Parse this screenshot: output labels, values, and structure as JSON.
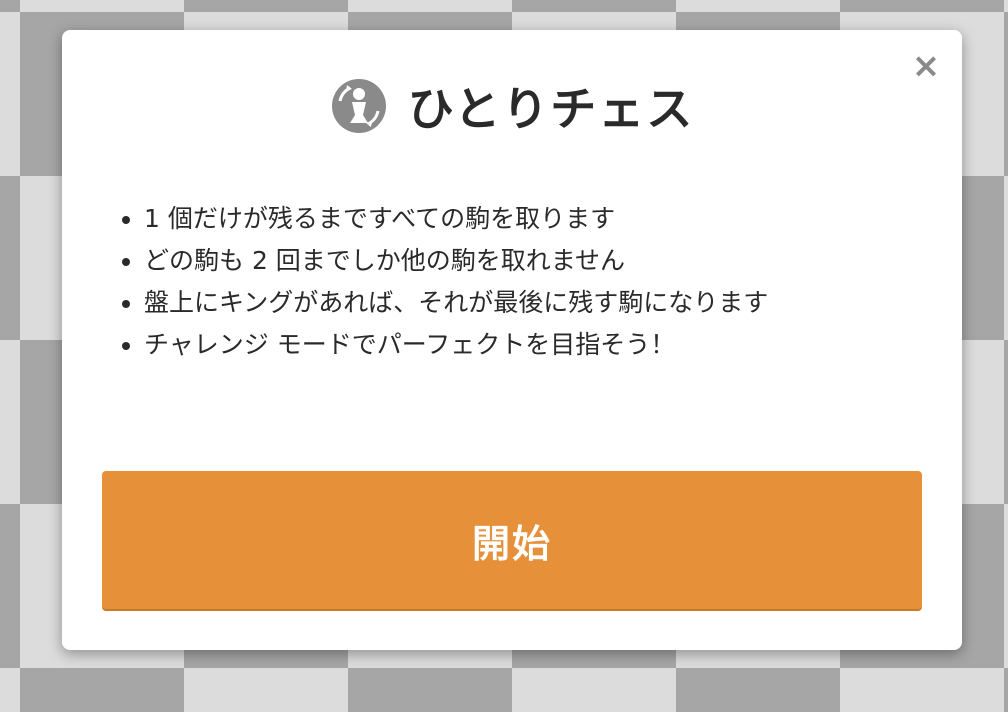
{
  "dialog": {
    "close_label": "×",
    "logo_icon": "solo-chess-piece-icon",
    "title": "ひとりチェス",
    "rules": [
      "1 個だけが残るまですべての駒を取ります",
      "どの駒も 2 回までしか他の駒を取れません",
      "盤上にキングがあれば、それが最後に残す駒になります",
      "チャレンジ モードでパーフェクトを目指そう！"
    ],
    "start_label": "開始"
  },
  "colors": {
    "accent": "#e6913a",
    "board_light": "#dcdcdc",
    "board_dark": "#a6a6a6",
    "title_text": "#2a2a2a",
    "icon_gray": "#8a8a8a"
  }
}
